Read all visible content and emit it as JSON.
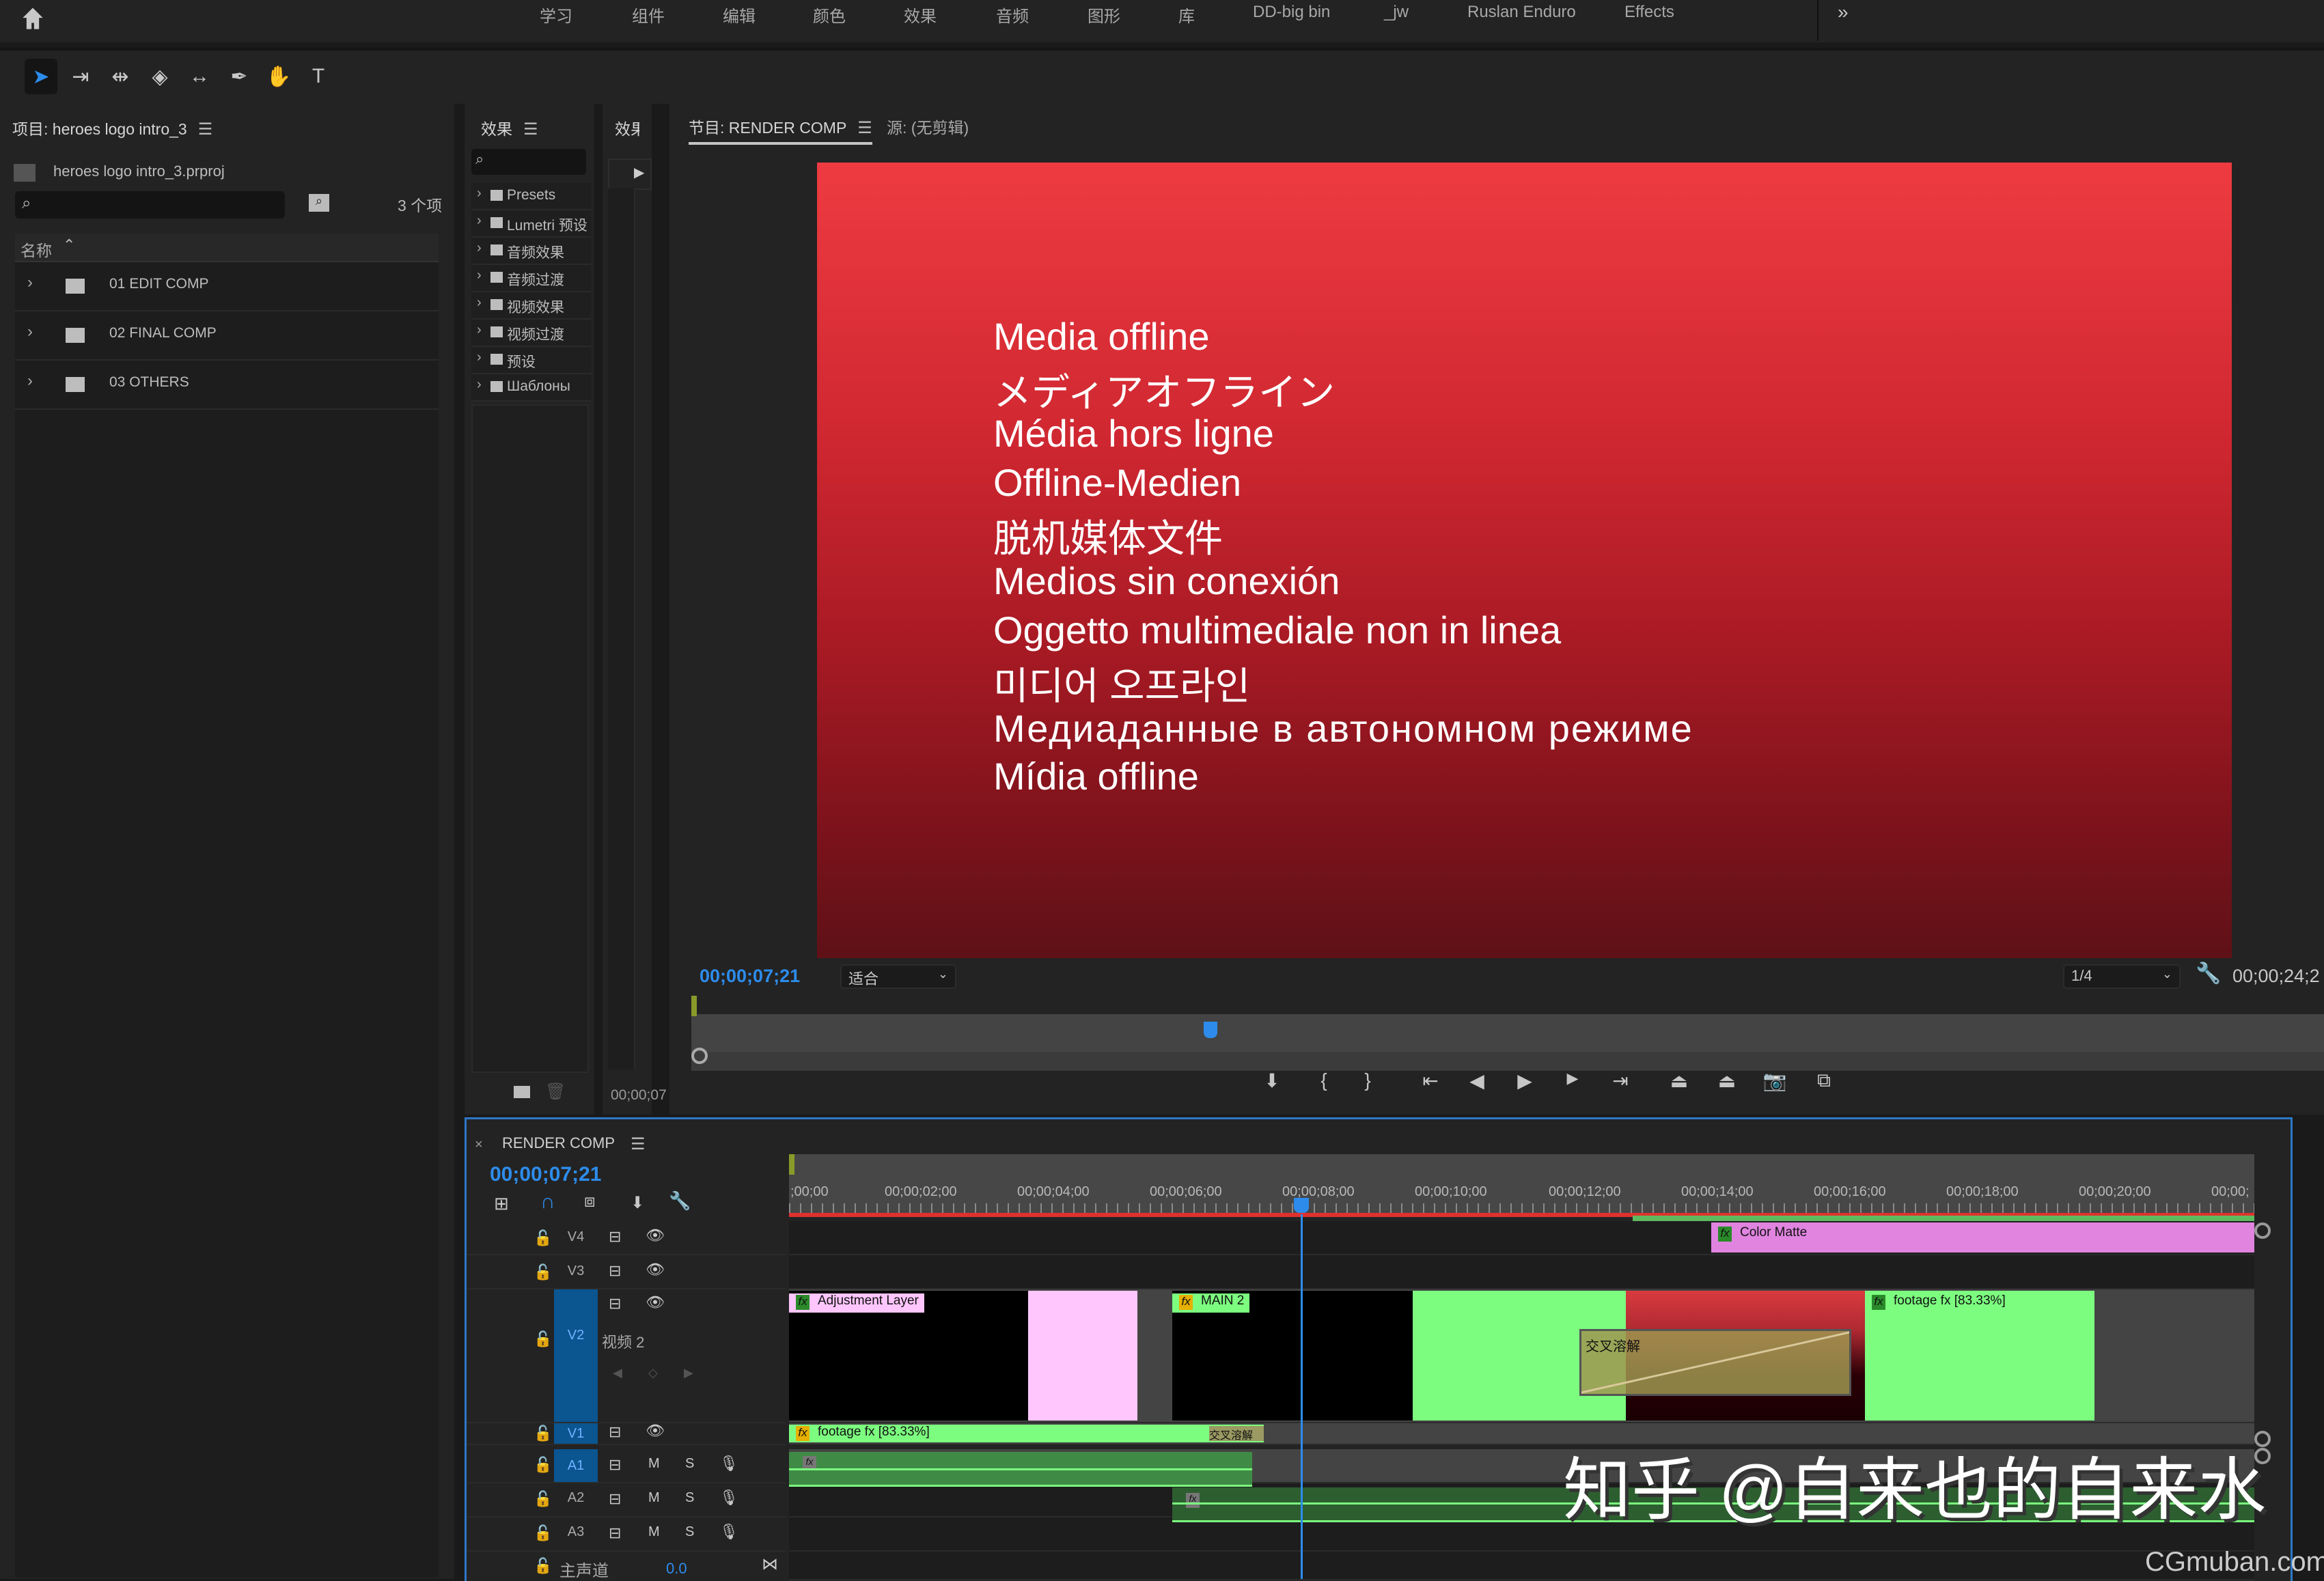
{
  "workspace": {
    "home_icon": "home-icon",
    "tabs": [
      "学习",
      "组件",
      "编辑",
      "颜色",
      "效果",
      "音频",
      "图形",
      "库",
      "DD-big bin",
      "_jw",
      "Ruslan Enduro",
      "Effects"
    ],
    "more_label": "»"
  },
  "tools": [
    {
      "name": "selection-tool",
      "glyph": "➤",
      "active": true
    },
    {
      "name": "track-select-tool",
      "glyph": "⇥"
    },
    {
      "name": "ripple-edit-tool",
      "glyph": "⇹"
    },
    {
      "name": "razor-tool",
      "glyph": "◈"
    },
    {
      "name": "slip-tool",
      "glyph": "↔"
    },
    {
      "name": "pen-tool",
      "glyph": "✒"
    },
    {
      "name": "hand-tool",
      "glyph": "✋"
    },
    {
      "name": "type-tool",
      "glyph": "T"
    }
  ],
  "project": {
    "title": "项目: heroes logo intro_3",
    "file": "heroes logo intro_3.prproj",
    "search_placeholder": "",
    "item_count": "3 个项",
    "column_name": "名称",
    "items": [
      "01 EDIT COMP",
      "02 FINAL COMP",
      "03 OTHERS"
    ]
  },
  "effects": {
    "title": "效果",
    "search_placeholder": "",
    "items": [
      "Presets",
      "Lumetri 预设",
      "音频效果",
      "音频过渡",
      "视频效果",
      "视频过渡",
      "预设",
      "Шаблоны"
    ]
  },
  "effects2": {
    "title": "效果",
    "timecode": "00;00;07"
  },
  "monitor": {
    "tab_program": "节目: RENDER COMP",
    "tab_source": "源: (无剪辑)",
    "offline_lines": [
      "Media offline",
      "メディアオフライン",
      "Média hors ligne",
      "Offline-Medien",
      "脱机媒体文件",
      "Medios sin conexión",
      "Oggetto multimediale non in linea",
      "미디어 오프라인",
      "Медиаданные в автономном режиме",
      "Mídia offline"
    ],
    "current_timecode": "00;00;07;21",
    "zoom_select": "适合",
    "resolution_select": "1/4",
    "duration_timecode": "00;00;24;2",
    "playhead_fraction": 0.318,
    "transport": [
      {
        "name": "add-marker-button",
        "glyph": "⬇"
      },
      {
        "name": "mark-in-button",
        "glyph": "{"
      },
      {
        "name": "mark-out-button",
        "glyph": "}"
      },
      {
        "name": "go-to-in-button",
        "glyph": "⇤"
      },
      {
        "name": "step-back-button",
        "glyph": "◀"
      },
      {
        "name": "play-button",
        "glyph": "▶"
      },
      {
        "name": "step-forward-button",
        "glyph": "▶"
      },
      {
        "name": "go-to-out-button",
        "glyph": "⇥"
      },
      {
        "name": "lift-button",
        "glyph": "⏏"
      },
      {
        "name": "extract-button",
        "glyph": "⏏"
      },
      {
        "name": "export-frame-button",
        "glyph": "📷"
      },
      {
        "name": "comparison-view-button",
        "glyph": "⧉"
      }
    ]
  },
  "timeline": {
    "title": "RENDER COMP",
    "current_timecode": "00;00;07;21",
    "ruler_labels": [
      ";00;00",
      "00;00;02;00",
      "00;00;04;00",
      "00;00;06;00",
      "00;00;08;00",
      "00;00;10;00",
      "00;00;12;00",
      "00;00;14;00",
      "00;00;16;00",
      "00;00;18;00",
      "00;00;20;00",
      "00;00;"
    ],
    "playhead_seconds": 7.7,
    "tracks": {
      "V4": {
        "label": "V4"
      },
      "V3": {
        "label": "V3"
      },
      "V2": {
        "label": "V2",
        "name": "视频 2"
      },
      "V1": {
        "label": "V1"
      },
      "A1": {
        "label": "A1"
      },
      "A2": {
        "label": "A2"
      },
      "A3": {
        "label": "A3"
      },
      "master": {
        "label": "主声道",
        "value": "0.0"
      }
    },
    "mute_label": "M",
    "solo_label": "S",
    "clips": {
      "color_matte": "Color Matte",
      "adjustment_layer": "Adjustment Layer",
      "main2": "MAIN 2",
      "footage_fx_v2": "footage fx [83.33%]",
      "footage_fx_v1": "footage fx [83.33%]",
      "transition": "交叉溶解",
      "transition_v1": "交叉溶解"
    },
    "colors": {
      "accent_blue": "#2d8ceb",
      "clip_green": "#7cfd7f",
      "clip_pink": "#ffc6fd",
      "color_matte": "#e084e0",
      "audio_green": "#3f8a45",
      "render_red": "#e0312f"
    }
  },
  "watermark": {
    "main": "知乎 @自来也的自来水",
    "site": "CGmuban.com"
  }
}
